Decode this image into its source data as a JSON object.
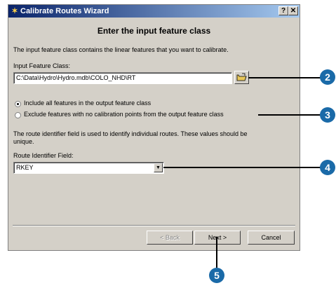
{
  "window": {
    "title": "Calibrate Routes Wizard",
    "help_button": "?",
    "close_button": "✕"
  },
  "heading": "Enter the input feature class",
  "description": "The input feature class contains the linear features that you want to calibrate.",
  "input_feature_class": {
    "label": "Input Feature Class:",
    "value": "C:\\Data\\Hydro\\Hydro.mdb\\COLO_NHD\\RT"
  },
  "options": [
    {
      "label": "Include all features in the output feature class",
      "selected": true
    },
    {
      "label": "Exclude features with no calibration points from the output feature class",
      "selected": false
    }
  ],
  "route_info": {
    "line1": "The route identifier field is used to identify individual routes.  These values should be",
    "line2": "unique."
  },
  "route_identifier": {
    "label": "Route Identifier Field:",
    "value": "RKEY"
  },
  "buttons": {
    "back": "< Back",
    "next": "Next >",
    "cancel": "Cancel"
  },
  "callouts": [
    "2",
    "3",
    "4",
    "5"
  ],
  "colors": {
    "callout": "#1a6aa8",
    "dialog": "#d4d0c8",
    "titlebar": "#0a246a"
  },
  "icons": {
    "title": "wizard-icon",
    "browse": "open-folder-icon",
    "dropdown": "chevron-down-icon"
  }
}
